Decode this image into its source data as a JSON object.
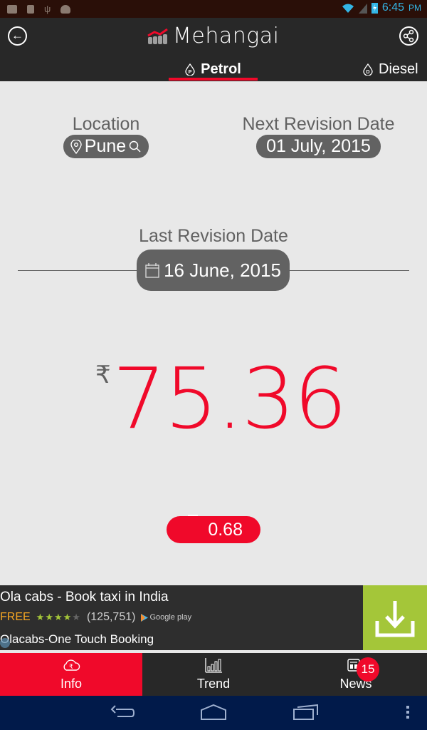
{
  "status_bar": {
    "time": "6:45",
    "ampm": "PM",
    "left_icons": [
      "gallery-icon",
      "sd-card-icon",
      "usb-icon",
      "android-icon"
    ],
    "right_icons": [
      "wifi-icon",
      "signal-icon",
      "battery-charging-icon"
    ]
  },
  "app_bar": {
    "title": "Mehangai",
    "back_icon": "back-arrow-icon",
    "share_icon": "share-icon"
  },
  "tabs": [
    {
      "label": "Petrol",
      "icon": "petrol-drop-icon",
      "badge_letter": "P",
      "active": true
    },
    {
      "label": "Diesel",
      "icon": "diesel-drop-icon",
      "badge_letter": "D",
      "active": false
    }
  ],
  "location": {
    "label": "Location",
    "value": "Pune"
  },
  "next_revision": {
    "label": "Next Revision Date",
    "value": "01 July, 2015"
  },
  "last_revision": {
    "label": "Last Revision Date",
    "value": "16 June, 2015"
  },
  "price": {
    "currency_symbol": "₹",
    "value": "75.36",
    "change": "0.68",
    "change_direction": "up"
  },
  "ad": {
    "title": "Ola cabs - Book taxi in India",
    "price_label": "FREE",
    "rating_stars": 4,
    "rating_max": 5,
    "rating_count": "(125,751)",
    "store": "Google play",
    "subtitle": "Olacabs-One Touch Booking",
    "cta_icon": "download-icon"
  },
  "bottom_nav": [
    {
      "label": "Info",
      "icon": "rupee-cloud-icon",
      "active": true
    },
    {
      "label": "Trend",
      "icon": "bar-chart-icon",
      "active": false
    },
    {
      "label": "News",
      "icon": "newspaper-icon",
      "active": false,
      "badge": "15"
    }
  ],
  "colors": {
    "accent": "#f0092a",
    "app_bar": "#282828",
    "pill": "#626262",
    "ad_cta": "#a4c639",
    "system_nav": "#011a4a"
  }
}
